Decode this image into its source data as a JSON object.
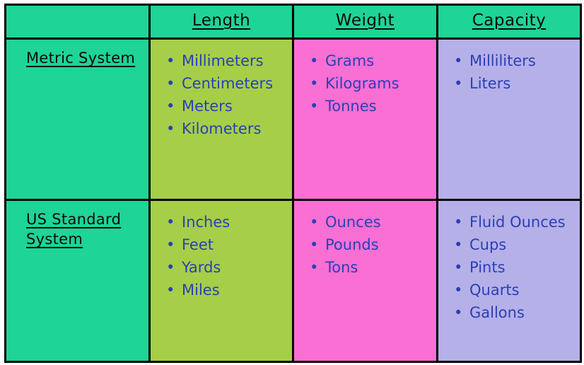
{
  "table": {
    "colors": {
      "row_label_bg": "#1ed496",
      "length_bg": "#a6ce48",
      "weight_bg": "#f96fd4",
      "capacity_bg": "#b6b0e8",
      "header_bg": "#1ed496",
      "border": "#000000",
      "item_text": "#2a40b5",
      "header_text": "#0a0a0a"
    },
    "headers": {
      "corner": "",
      "length": "Length",
      "weight": "Weight",
      "capacity": "Capacity"
    },
    "rows": [
      {
        "label_line1": "Metric System",
        "label_line2": "",
        "length": [
          "Millimeters",
          "Centimeters",
          "Meters",
          "Kilometers"
        ],
        "weight": [
          "Grams",
          "Kilograms",
          "Tonnes"
        ],
        "capacity": [
          "Milliliters",
          "Liters"
        ]
      },
      {
        "label_line1": "US Standard",
        "label_line2": "System",
        "length": [
          "Inches",
          "Feet",
          "Yards",
          "Miles"
        ],
        "weight": [
          "Ounces",
          "Pounds",
          "Tons"
        ],
        "capacity": [
          "Fluid Ounces",
          "Cups",
          "Pints",
          "Quarts",
          "Gallons"
        ]
      }
    ]
  }
}
